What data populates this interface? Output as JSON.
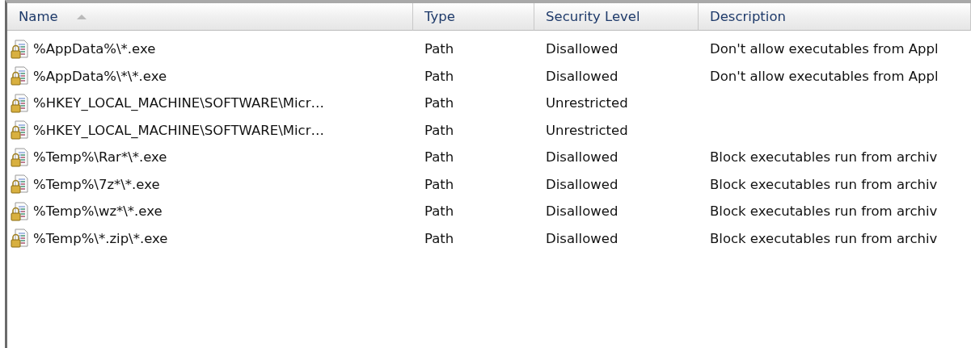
{
  "table": {
    "columns": [
      {
        "label": "Name",
        "sorted": true
      },
      {
        "label": "Type",
        "sorted": false
      },
      {
        "label": "Security Level",
        "sorted": false
      },
      {
        "label": "Description",
        "sorted": false
      }
    ],
    "rows": [
      {
        "name": "%AppData%\\*.exe",
        "type": "Path",
        "security_level": "Disallowed",
        "description": "Don't allow executables from Appl"
      },
      {
        "name": "%AppData%\\*\\*.exe",
        "type": "Path",
        "security_level": "Disallowed",
        "description": "Don't allow executables from Appl"
      },
      {
        "name": "%HKEY_LOCAL_MACHINE\\SOFTWARE\\Micr…",
        "type": "Path",
        "security_level": "Unrestricted"
      },
      {
        "name": "%HKEY_LOCAL_MACHINE\\SOFTWARE\\Micr…",
        "type": "Path",
        "security_level": "Unrestricted"
      },
      {
        "name": "%Temp%\\Rar*\\*.exe",
        "type": "Path",
        "security_level": "Disallowed",
        "description": "Block executables run from archiv"
      },
      {
        "name": "%Temp%\\7z*\\*.exe",
        "type": "Path",
        "security_level": "Disallowed",
        "description": "Block executables run from archiv"
      },
      {
        "name": "%Temp%\\wz*\\*.exe",
        "type": "Path",
        "security_level": "Disallowed",
        "description": "Block executables run from archiv"
      },
      {
        "name": "%Temp%\\*.zip\\*.exe",
        "type": "Path",
        "security_level": "Disallowed",
        "description": "Block executables run from archiv"
      }
    ]
  }
}
